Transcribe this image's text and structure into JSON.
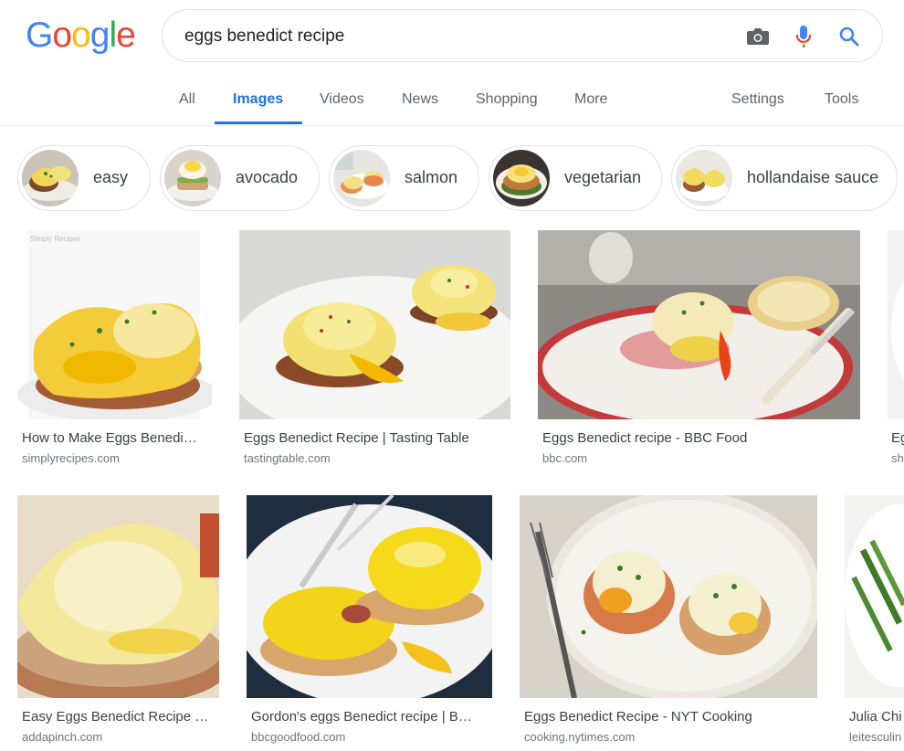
{
  "logo": {
    "text": "Google",
    "colors": [
      "#4285f4",
      "#ea4335",
      "#fbbc05",
      "#4285f4",
      "#34a853",
      "#ea4335"
    ]
  },
  "search": {
    "query": "eggs benedict recipe",
    "icons": [
      "camera-icon",
      "mic-icon",
      "search-icon"
    ]
  },
  "tabs": {
    "all": "All",
    "images": "Images",
    "videos": "Videos",
    "news": "News",
    "shopping": "Shopping",
    "more": "More",
    "settings": "Settings",
    "tools": "Tools",
    "active": "Images"
  },
  "chips": [
    "easy",
    "avocado",
    "salmon",
    "vegetarian",
    "hollandaise sauce"
  ],
  "results": [
    {
      "title": "How to Make Eggs Benedi…",
      "domain": "simplyrecipes.com"
    },
    {
      "title": "Eggs Benedict Recipe | Tasting Table",
      "domain": "tastingtable.com"
    },
    {
      "title": "Eggs Benedict recipe - BBC Food",
      "domain": "bbc.com"
    },
    {
      "title": "Eg",
      "domain": "sh"
    },
    {
      "title": "Easy Eggs Benedict Recipe …",
      "domain": "addapinch.com"
    },
    {
      "title": "Gordon's eggs Benedict recipe | B…",
      "domain": "bbcgoodfood.com"
    },
    {
      "title": "Eggs Benedict Recipe - NYT Cooking",
      "domain": "cooking.nytimes.com"
    },
    {
      "title": "Julia Chi",
      "domain": "leitesculin"
    }
  ],
  "colors": {
    "accent": "#1a73e8",
    "text": "#3c4043",
    "muted": "#70757a",
    "hollandaise": "#f3d34a",
    "yolk": "#f7b500"
  }
}
